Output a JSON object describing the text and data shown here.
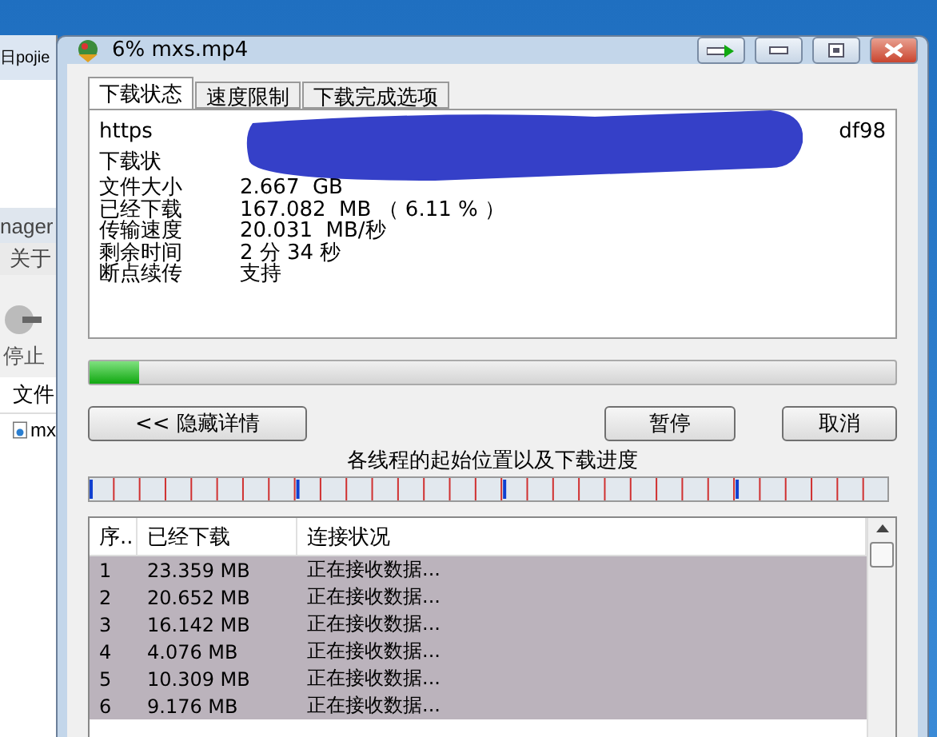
{
  "background_window": {
    "title_fragment": "日pojie",
    "menu_fragment": "nager",
    "menu_item": "关于",
    "toolbar_button": "停止",
    "column_header": "文件",
    "file_fragment": "mx"
  },
  "window": {
    "title": "6% mxs.mp4"
  },
  "tabs": [
    {
      "label": "下载状态",
      "selected": true
    },
    {
      "label": "速度限制",
      "selected": false
    },
    {
      "label": "下载完成选项",
      "selected": false
    }
  ],
  "status": {
    "url_start": "https",
    "url_end": "df98",
    "status_fragment": "下载状",
    "rows": [
      {
        "label": "文件大小",
        "value": "2.667  GB"
      },
      {
        "label": "已经下载",
        "value": "167.082  MB （ 6.11 % ）"
      },
      {
        "label": "传输速度",
        "value": "20.031  MB/秒"
      },
      {
        "label": "剩余时间",
        "value": "2 分 34 秒"
      },
      {
        "label": "断点续传",
        "value": "支持"
      }
    ]
  },
  "progress": {
    "level": 0.0611
  },
  "buttons": {
    "details": "<< 隐藏详情",
    "pause": "暂停",
    "cancel": "取消"
  },
  "threads_caption": "各线程的起始位置以及下载进度",
  "connections": {
    "columns": [
      "序..",
      "已经下载",
      "连接状况"
    ],
    "rows": [
      {
        "index": "1",
        "downloaded": "23.359 MB",
        "state": "正在接收数据...",
        "selected": true
      },
      {
        "index": "2",
        "downloaded": "20.652 MB",
        "state": "正在接收数据...",
        "selected": true
      },
      {
        "index": "3",
        "downloaded": "16.142 MB",
        "state": "正在接收数据...",
        "selected": true
      },
      {
        "index": "4",
        "downloaded": "4.076 MB",
        "state": "正在接收数据...",
        "selected": true
      },
      {
        "index": "5",
        "downloaded": "10.309 MB",
        "state": "正在接收数据...",
        "selected": true
      },
      {
        "index": "6",
        "downloaded": "9.176 MB",
        "state": "正在接收数据...",
        "selected": true
      }
    ]
  }
}
